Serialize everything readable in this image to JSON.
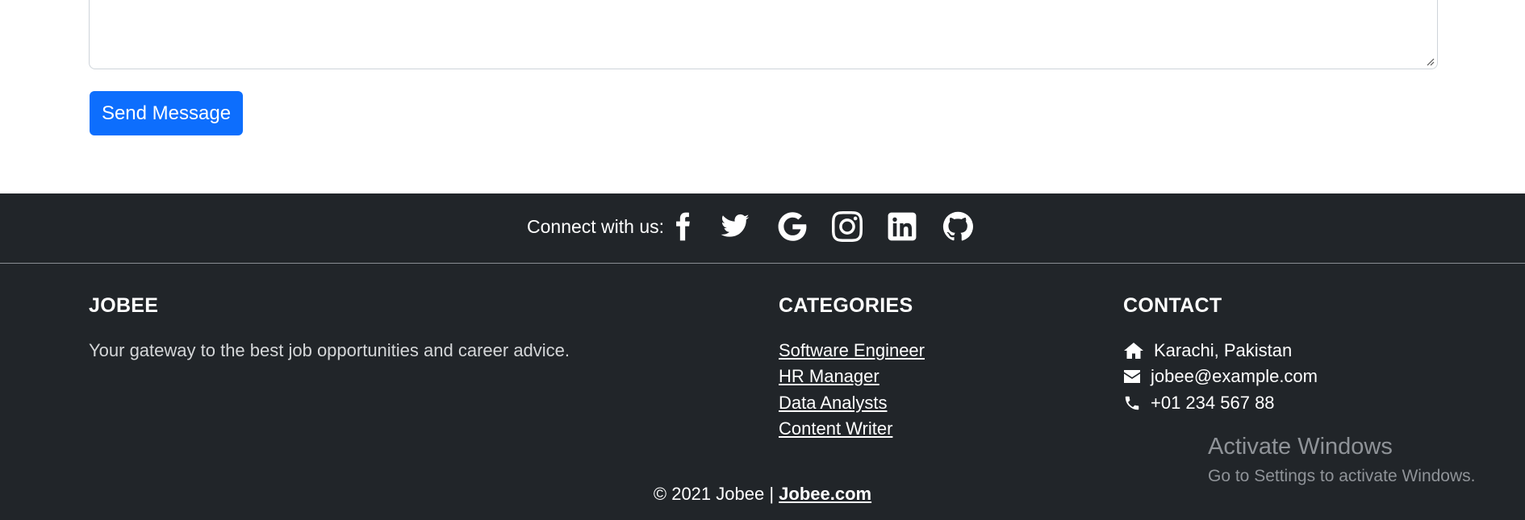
{
  "form": {
    "send_label": "Send Message"
  },
  "social": {
    "label": "Connect with us:",
    "icons": [
      "facebook-icon",
      "twitter-icon",
      "google-icon",
      "instagram-icon",
      "linkedin-icon",
      "github-icon"
    ]
  },
  "about": {
    "title": "JOBEE",
    "text": "Your gateway to the best job opportunities and career advice."
  },
  "categories": {
    "title": "CATEGORIES",
    "items": [
      "Software Engineer",
      "HR Manager",
      "Data Analysts",
      "Content Writer"
    ]
  },
  "contact": {
    "title": "CONTACT",
    "address": "Karachi, Pakistan",
    "email": "jobee@example.com",
    "phone": "+01 234 567 88"
  },
  "copyright": {
    "text": "© 2021 Jobee |",
    "link": "Jobee.com"
  },
  "watermark": {
    "title": "Activate Windows",
    "subtitle": "Go to Settings to activate Windows."
  },
  "colors": {
    "primary": "#0d6efd",
    "footer_bg": "#212529"
  }
}
